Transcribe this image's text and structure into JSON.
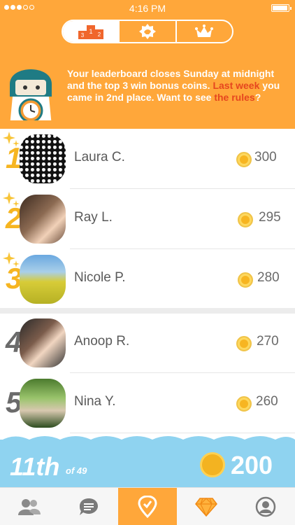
{
  "status": {
    "time": "4:16 PM"
  },
  "banner": {
    "text_before": "Your leaderboard closes Sunday at midnight and the top 3 win bonus coins. ",
    "link_last_week": "Last week",
    "text_middle": " you came in 2nd place. Want to see ",
    "link_rules": "the rules",
    "text_after": "?"
  },
  "leaderboard": [
    {
      "rank": "1",
      "name": "Laura C.",
      "score": "300",
      "top3": true
    },
    {
      "rank": "2",
      "name": "Ray L.",
      "score": "295",
      "top3": true
    },
    {
      "rank": "3",
      "name": "Nicole P.",
      "score": "280",
      "top3": true
    },
    {
      "rank": "4",
      "name": "Anoop R.",
      "score": "270",
      "top3": false
    },
    {
      "rank": "5",
      "name": "Nina Y.",
      "score": "260",
      "top3": false
    }
  ],
  "me": {
    "rank": "11th",
    "of": "of 49",
    "score": "200"
  },
  "podium_label": "3 1 2",
  "colors": {
    "accent": "#ffa73a",
    "gold": "#f6b521",
    "sky": "#8fd3f0",
    "link": "#e6461f"
  },
  "tabs": [
    {
      "icon": "friends-icon"
    },
    {
      "icon": "chat-icon"
    },
    {
      "icon": "checkin-pin-icon",
      "active": true
    },
    {
      "icon": "gem-icon"
    },
    {
      "icon": "profile-icon"
    }
  ],
  "header_tabs": [
    {
      "icon": "podium-icon",
      "active": true
    },
    {
      "icon": "badge-icon"
    },
    {
      "icon": "crown-icon"
    }
  ]
}
